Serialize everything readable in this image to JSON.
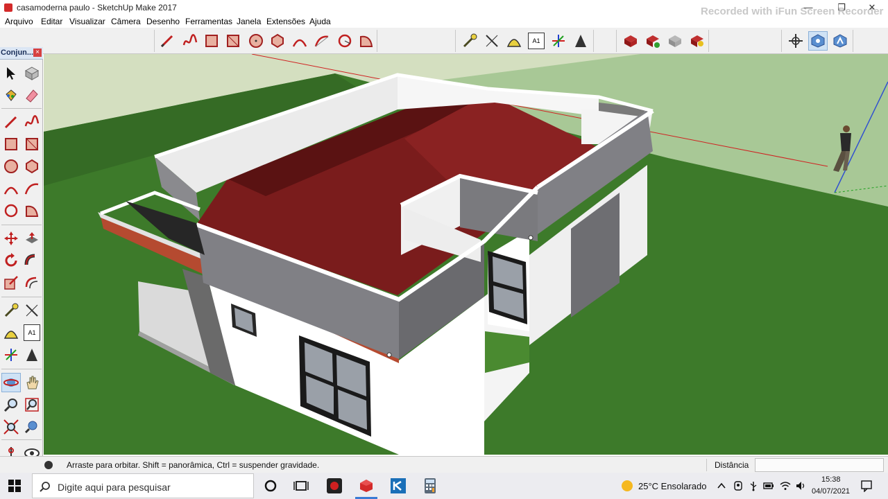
{
  "window": {
    "title": "casamoderna paulo - SketchUp Make 2017",
    "watermark": "Recorded with iFun Screen Recorder",
    "min_glyph": "—",
    "max_glyph": "❐",
    "close_glyph": "✕"
  },
  "menu": {
    "items": [
      "Arquivo",
      "Editar",
      "Visualizar",
      "Câmera",
      "Desenho",
      "Ferramentas",
      "Janela",
      "Extensões",
      "Ajuda"
    ]
  },
  "toolbar": {
    "text_tool_label": "A1"
  },
  "tray": {
    "title": "Conjun...",
    "close_glyph": "×",
    "text_tool_label": "A1"
  },
  "status": {
    "hint": "Arraste para orbitar. Shift = panorâmica, Ctrl = suspender gravidade.",
    "distance_label": "Distância",
    "distance_value": ""
  },
  "taskbar": {
    "search_placeholder": "Digite aqui para pesquisar",
    "weather": "25°C  Ensolarado",
    "time": "15:38",
    "date": "04/07/2021"
  },
  "colors": {
    "sky": "#d4dfc0",
    "ground_light": "#a8c896",
    "grass": "#3d7a2a",
    "roof": "#7a1c1c",
    "wall": "#ffffff",
    "parapet": "#808085",
    "red_axis": "#d02020",
    "blue_axis": "#3050d0"
  }
}
